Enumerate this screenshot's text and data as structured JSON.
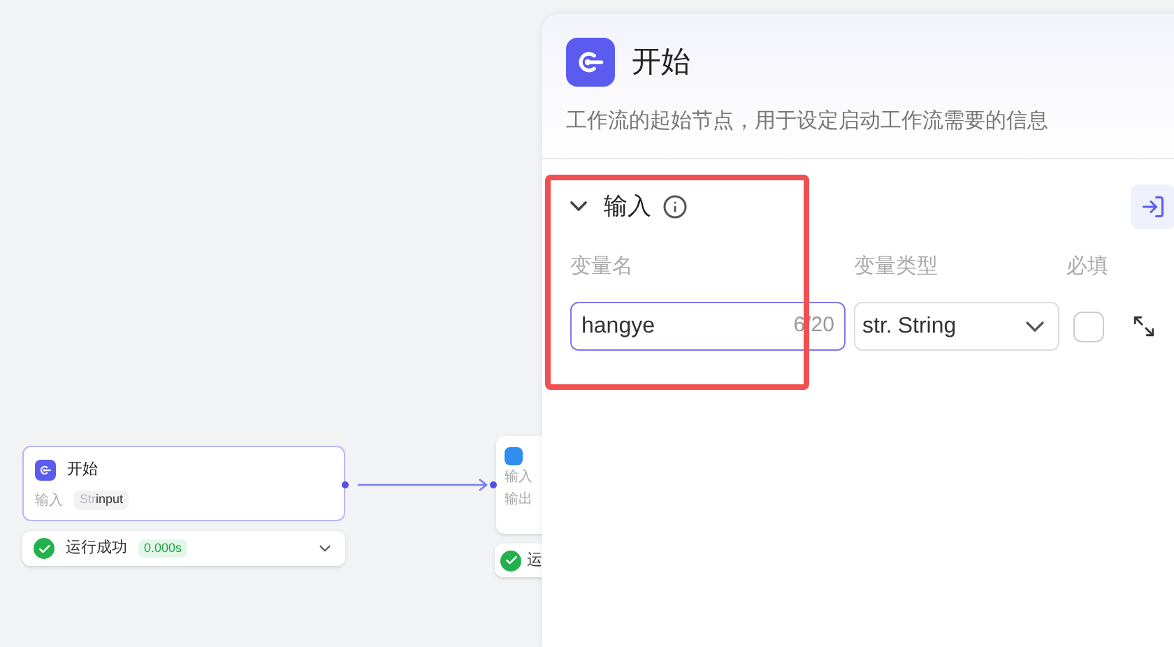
{
  "canvas": {
    "nodes": [
      {
        "kind": "start",
        "title": "开始",
        "fields": [
          {
            "label": "输入",
            "type_tag": "Str",
            "value": "input"
          }
        ],
        "status": {
          "text": "运行成功",
          "time": "0.000s",
          "expanded": false
        }
      },
      {
        "kind": "partial",
        "fields": [
          {
            "label": "输入"
          },
          {
            "label": "输出"
          }
        ],
        "status": {
          "text": "运"
        }
      }
    ]
  },
  "panel": {
    "title": "开始",
    "description": "工作流的起始节点，用于设定启动工作流需要的信息",
    "section": {
      "title": "输入",
      "expanded": true,
      "columns": [
        "变量名",
        "变量类型",
        "必填"
      ],
      "rows": [
        {
          "name": "hangye",
          "count": "6/20",
          "type_prefix": "str.",
          "type": "String",
          "required": false
        }
      ]
    },
    "highlight": true
  }
}
